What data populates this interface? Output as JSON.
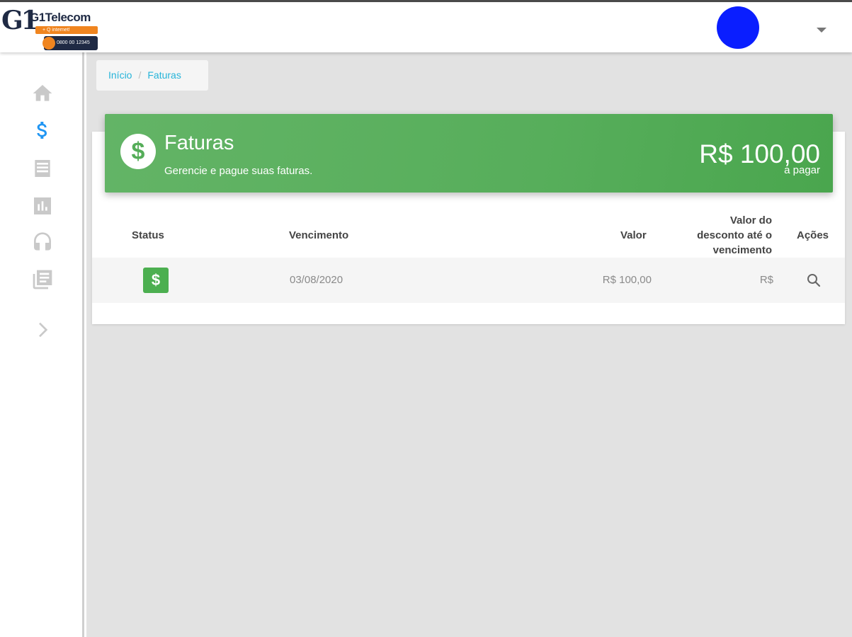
{
  "header": {
    "logo": {
      "mark": "G1",
      "name": "G1Telecom",
      "tagline": "+ Q internet!",
      "phone": "0800 00 12345"
    },
    "avatar_color": "#0a1eff",
    "caret_icon": "caret-down-icon"
  },
  "sidebar": {
    "items": [
      {
        "name": "home",
        "icon": "home-icon",
        "active": false
      },
      {
        "name": "faturas",
        "icon": "dollar-icon",
        "active": true
      },
      {
        "name": "list",
        "icon": "list-icon",
        "active": false
      },
      {
        "name": "reports",
        "icon": "chart-icon",
        "active": false
      },
      {
        "name": "support",
        "icon": "headset-icon",
        "active": false
      },
      {
        "name": "documents",
        "icon": "library-books-icon",
        "active": false
      }
    ],
    "expand_icon": "chevron-right-icon",
    "active_color": "#2196f3",
    "inactive_color": "#c9c9c9"
  },
  "breadcrumb": {
    "home": "Início",
    "separator": "/",
    "current": "Faturas"
  },
  "page_header": {
    "title": "Faturas",
    "subtitle": "Gerencie e pague suas faturas.",
    "amount": "R$ 100,00",
    "amount_label": "a pagar",
    "color": "#5cb160"
  },
  "table": {
    "columns": {
      "status": "Status",
      "vencimento": "Vencimento",
      "valor": "Valor",
      "desconto_line1": "Valor do",
      "desconto_line2": "desconto até o",
      "desconto_line3": "vencimento",
      "acoes": "Ações"
    },
    "rows": [
      {
        "status_icon": "dollar-icon",
        "status_color": "#4caf50",
        "status_symbol": "$",
        "vencimento": "03/08/2020",
        "valor": "R$ 100,00",
        "desconto": "R$",
        "action_icon": "search-icon"
      }
    ]
  }
}
